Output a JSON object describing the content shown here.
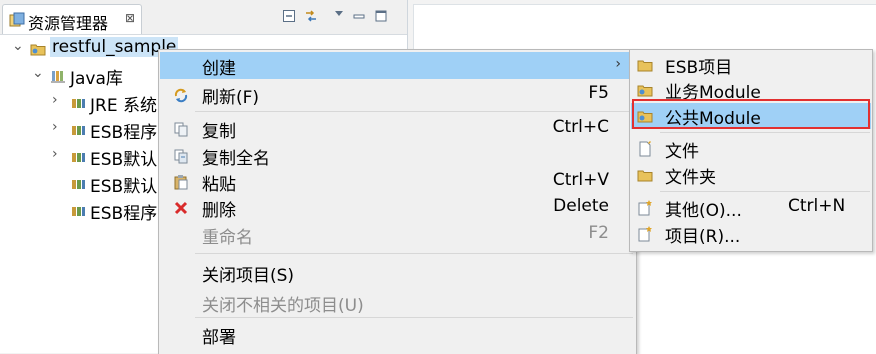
{
  "view": {
    "tab_title": "资源管理器",
    "close_glyph": "⊠",
    "toolbar_icons": [
      "collapse-all-icon",
      "link-editor-icon",
      "view-menu-icon",
      "minimize-icon",
      "maximize-icon"
    ]
  },
  "tree": {
    "project": "restful_sample",
    "library": "Java库",
    "children": [
      "JRE 系统",
      "ESB程序",
      "ESB默认",
      "ESB默认",
      "ESB程序"
    ]
  },
  "menu": {
    "create": "创建",
    "refresh": "刷新(F)",
    "refresh_key": "F5",
    "copy": "复制",
    "copy_key": "Ctrl+C",
    "copy_full_name": "复制全名",
    "paste": "粘贴",
    "paste_key": "Ctrl+V",
    "delete": "删除",
    "delete_key": "Delete",
    "rename": "重命名",
    "rename_key": "F2",
    "close_project": "关闭项目(S)",
    "close_unrelated": "关闭不相关的项目(U)",
    "deploy": "部署"
  },
  "submenu": {
    "esb_project": "ESB项目",
    "business_module": "业务Module",
    "common_module": "公共Module",
    "file": "文件",
    "folder": "文件夹",
    "other": "其他(O)...",
    "other_key": "Ctrl+N",
    "project": "项目(R)..."
  },
  "colors": {
    "selection": "#cce4f7",
    "menu_hover": "#9fd0f6",
    "highlight_border": "#e23030",
    "folder": "#e8c25a"
  }
}
